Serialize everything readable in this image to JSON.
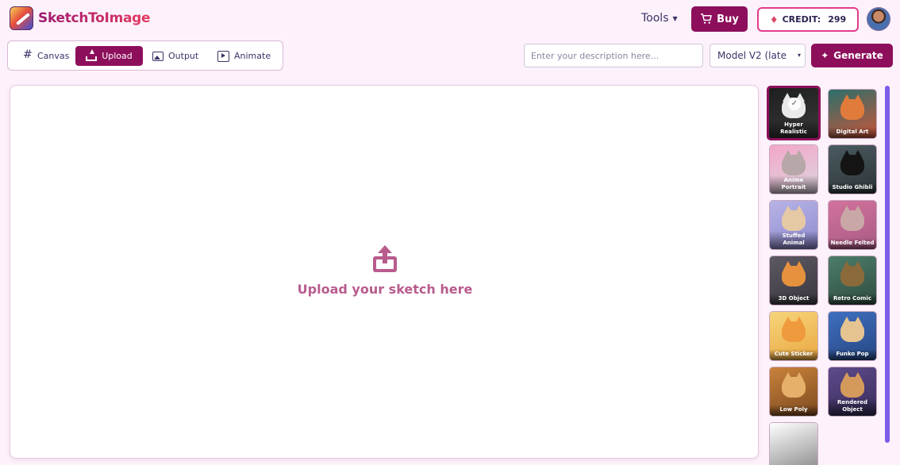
{
  "app": {
    "title": "SketchToImage",
    "title_gradient": [
      "#9c1a6e",
      "#e53b64"
    ],
    "accent": "#8d0f5c"
  },
  "header": {
    "tools_label": "Tools",
    "buy_label": "Buy",
    "credit_label": "CREDIT:",
    "credit_value": "299"
  },
  "mode_tabs": [
    {
      "label": "Canvas",
      "icon": "grid-icon",
      "active": false
    },
    {
      "label": "Upload",
      "icon": "upload-icon",
      "active": true
    },
    {
      "label": "Output",
      "icon": "image-icon",
      "active": false
    },
    {
      "label": "Animate",
      "icon": "play-icon",
      "active": false
    }
  ],
  "prompt": {
    "placeholder": "Enter your description here...",
    "value": ""
  },
  "model_select": {
    "selected": "Model V2 (late"
  },
  "generate_label": "Generate",
  "upload": {
    "prompt_text": "Upload your sketch here",
    "icon_color": "#b85c8d"
  },
  "styles": [
    {
      "label": "Hyper Realistic",
      "selected": true,
      "bg": [
        "#1e1e1e",
        "#3a3a3a"
      ],
      "cat": "#e9e9e9"
    },
    {
      "label": "Digital Art",
      "selected": false,
      "bg": [
        "#2c6f6a",
        "#c9553a"
      ],
      "cat": "#e07b3c"
    },
    {
      "label": "Anime Portrait",
      "selected": false,
      "bg": [
        "#f3a6c8",
        "#dcd6e0"
      ],
      "cat": "#b7a7a8"
    },
    {
      "label": "Studio Ghibli",
      "selected": false,
      "bg": [
        "#4b5b60",
        "#2b3438"
      ],
      "cat": "#141414"
    },
    {
      "label": "Stuffed Animal",
      "selected": false,
      "bg": [
        "#b7b3e6",
        "#8e8ad0"
      ],
      "cat": "#e5c9a4"
    },
    {
      "label": "Needle Felted",
      "selected": false,
      "bg": [
        "#d2739c",
        "#a85a84"
      ],
      "cat": "#c9a7a6"
    },
    {
      "label": "3D Object",
      "selected": false,
      "bg": [
        "#5d5963",
        "#3a3740"
      ],
      "cat": "#e6913e"
    },
    {
      "label": "Retro Comic",
      "selected": false,
      "bg": [
        "#4c7d6a",
        "#2f4c3f"
      ],
      "cat": "#8a6a3a"
    },
    {
      "label": "Cute Sticker",
      "selected": false,
      "bg": [
        "#f6d57a",
        "#eaa742"
      ],
      "cat": "#f09a3e"
    },
    {
      "label": "Funko Pop",
      "selected": false,
      "bg": [
        "#3f6fc0",
        "#274882"
      ],
      "cat": "#e5c491"
    },
    {
      "label": "Low Poly",
      "selected": false,
      "bg": [
        "#c9823b",
        "#7d4a1f"
      ],
      "cat": "#e7b06a"
    },
    {
      "label": "Rendered Object",
      "selected": false,
      "bg": [
        "#5d4a8a",
        "#3a2d5c"
      ],
      "cat": "#d49a5c"
    },
    {
      "label": "",
      "selected": false,
      "bg": [
        "#ffffff",
        "#8a8a8a"
      ],
      "cat": ""
    }
  ]
}
